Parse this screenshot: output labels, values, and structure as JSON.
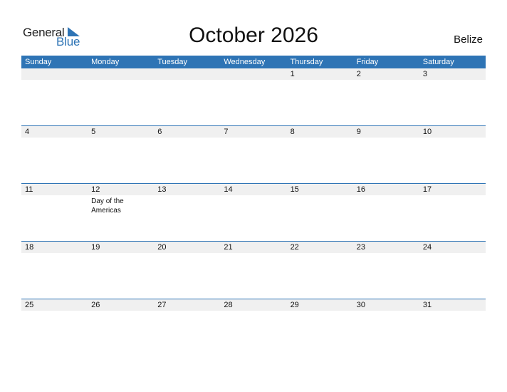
{
  "logo": {
    "line1": "General",
    "line2": "Blue"
  },
  "title": "October 2026",
  "country": "Belize",
  "colors": {
    "accent": "#2e74b5",
    "date_strip": "#f0f0f0"
  },
  "weekdays": [
    "Sunday",
    "Monday",
    "Tuesday",
    "Wednesday",
    "Thursday",
    "Friday",
    "Saturday"
  ],
  "weeks": [
    [
      {
        "day": ""
      },
      {
        "day": ""
      },
      {
        "day": ""
      },
      {
        "day": ""
      },
      {
        "day": "1"
      },
      {
        "day": "2"
      },
      {
        "day": "3"
      }
    ],
    [
      {
        "day": "4"
      },
      {
        "day": "5"
      },
      {
        "day": "6"
      },
      {
        "day": "7"
      },
      {
        "day": "8"
      },
      {
        "day": "9"
      },
      {
        "day": "10"
      }
    ],
    [
      {
        "day": "11"
      },
      {
        "day": "12",
        "event": "Day of the Americas"
      },
      {
        "day": "13"
      },
      {
        "day": "14"
      },
      {
        "day": "15"
      },
      {
        "day": "16"
      },
      {
        "day": "17"
      }
    ],
    [
      {
        "day": "18"
      },
      {
        "day": "19"
      },
      {
        "day": "20"
      },
      {
        "day": "21"
      },
      {
        "day": "22"
      },
      {
        "day": "23"
      },
      {
        "day": "24"
      }
    ],
    [
      {
        "day": "25"
      },
      {
        "day": "26"
      },
      {
        "day": "27"
      },
      {
        "day": "28"
      },
      {
        "day": "29"
      },
      {
        "day": "30"
      },
      {
        "day": "31"
      }
    ]
  ]
}
